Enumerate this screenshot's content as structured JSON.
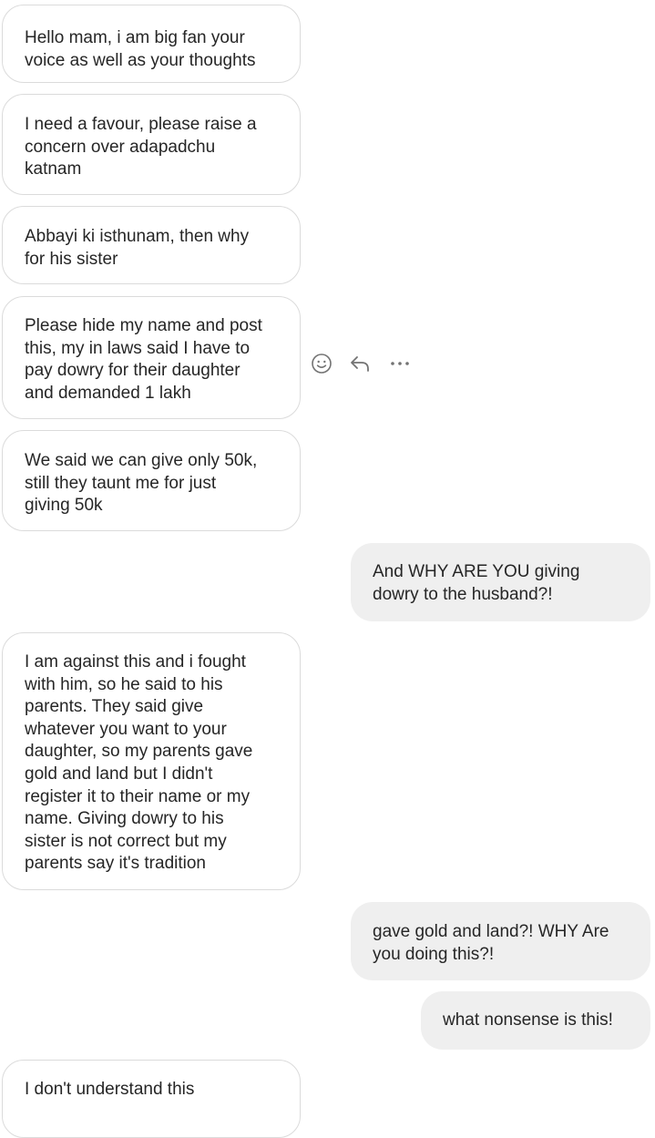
{
  "messages": [
    {
      "direction": "received",
      "text": "Hello mam, i am big fan your\nvoice as well as your thoughts"
    },
    {
      "direction": "received",
      "text": "I need a favour, please raise a\nconcern over adapadchu\nkatnam"
    },
    {
      "direction": "received",
      "text": "Abbayi ki isthunam, then why\nfor his sister"
    },
    {
      "direction": "received",
      "text": "Please hide my name and post\nthis, my in laws said I have to\npay dowry for their daughter\nand demanded 1 lakh"
    },
    {
      "direction": "received",
      "text": "We said we can give only 50k,\nstill they taunt me for just\ngiving 50k"
    },
    {
      "direction": "sent",
      "text": "And WHY ARE YOU giving\ndowry to the husband?!"
    },
    {
      "direction": "received",
      "text": "I am against this and i fought\nwith him, so he said to his\nparents. They said give\nwhatever you want to your\ndaughter, so my parents gave\ngold and land but I didn't\nregister it to their name or my\nname. Giving dowry to his\nsister is not correct but my\nparents say it's tradition"
    },
    {
      "direction": "sent",
      "text": "gave gold and land?! WHY Are\nyou doing this?!"
    },
    {
      "direction": "sent",
      "text": "what nonsense is this!"
    },
    {
      "direction": "received",
      "text": "I don't understand this"
    }
  ],
  "hover_actions": {
    "react": {
      "icon": "smiley-icon"
    },
    "reply": {
      "icon": "reply-arrow-icon"
    },
    "more": {
      "icon": "more-dots-icon"
    }
  },
  "colors": {
    "received_bubble_bg": "#ffffff",
    "received_bubble_border": "#dbdbdb",
    "sent_bubble_bg": "#efefef",
    "text": "#262626",
    "icon": "#737373"
  }
}
